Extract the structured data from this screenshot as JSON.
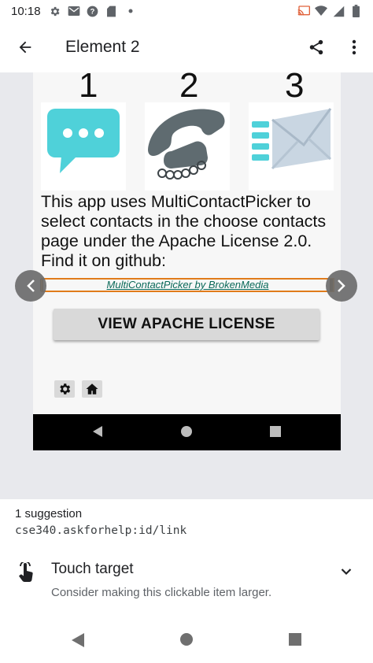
{
  "status_bar": {
    "time": "10:18",
    "left_icons": [
      "gear-icon",
      "gmail-icon",
      "help-icon",
      "sd-card-icon",
      "dot-icon"
    ],
    "right_icons": [
      "cast-icon",
      "wifi-icon",
      "signal-icon",
      "battery-icon"
    ]
  },
  "app_bar": {
    "title": "Element 2",
    "back_icon": "arrow-back-icon",
    "share_icon": "share-icon",
    "more_icon": "more-vert-icon"
  },
  "preview": {
    "digits": [
      "1",
      "2",
      "3"
    ],
    "tile_icons": [
      "chat-bubble-icon",
      "telephone-icon",
      "envelope-icon"
    ],
    "paragraph": "This app uses MultiContactPicker to select contacts in the choose contacts page under the Apache License 2.0. Find it on github:",
    "link_text": "MultiContactPicker by BrokenMedia",
    "license_button": "VIEW APACHE LICENSE",
    "bottom_buttons": [
      "gear-icon",
      "home-icon"
    ],
    "highlight_color": "#e07b1a",
    "link_color": "#0b6a5a"
  },
  "suggestions": {
    "count_label": "1 suggestion",
    "resource_id": "cse340.askforhelp:id/link",
    "item": {
      "title": "Touch target",
      "description": "Consider making this clickable item larger.",
      "icon": "touch-hand-icon"
    }
  },
  "colors": {
    "preview_background": "#e8e9ed",
    "chat_icon": "#4fd1d9",
    "phone_icon": "#5f6b70",
    "envelope_icon": "#c9d6e2"
  }
}
